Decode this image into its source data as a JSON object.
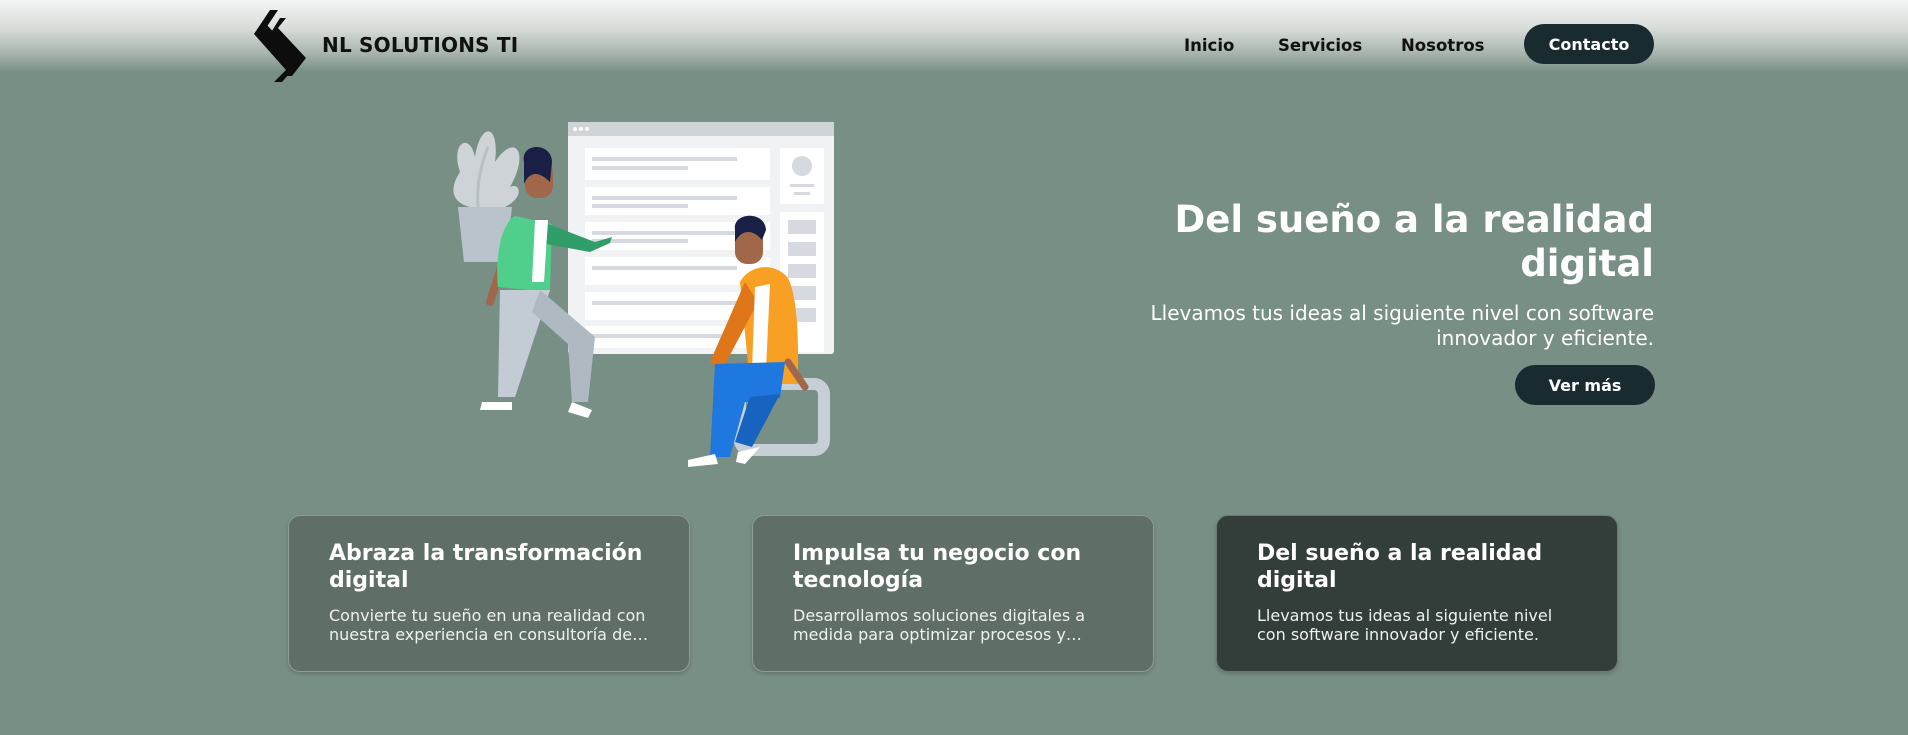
{
  "header": {
    "brand": "NL SOLUTIONS TI",
    "nav": {
      "inicio": "Inicio",
      "servicios": "Servicios",
      "nosotros": "Nosotros",
      "contacto": "Contacto"
    }
  },
  "hero": {
    "title": "Del sueño a la realidad digital",
    "subtitle": "Llevamos tus ideas al siguiente nivel con software innovador y eficiente.",
    "cta": "Ver más"
  },
  "cards": [
    {
      "title": "Abraza la transformación digital",
      "description": "Convierte tu sueño en una realidad con nuestra experiencia en consultoría de…"
    },
    {
      "title": "Impulsa tu negocio con tecnología",
      "description": "Desarrollamos soluciones digitales a medida para optimizar procesos y hac…"
    },
    {
      "title": "Del sueño a la realidad digital",
      "description": "Llevamos tus ideas al siguiente nivel con software innovador y eficiente."
    }
  ],
  "colors": {
    "background": "#788f85",
    "button": "#1a2b30",
    "card": "#5f6f67",
    "card_active": "#333d39",
    "accent_orange": "#f7a023",
    "accent_green": "#4fcf8b",
    "accent_blue": "#1e78e0"
  },
  "icons": {
    "logo": "chevron-arrows-logo-icon"
  }
}
